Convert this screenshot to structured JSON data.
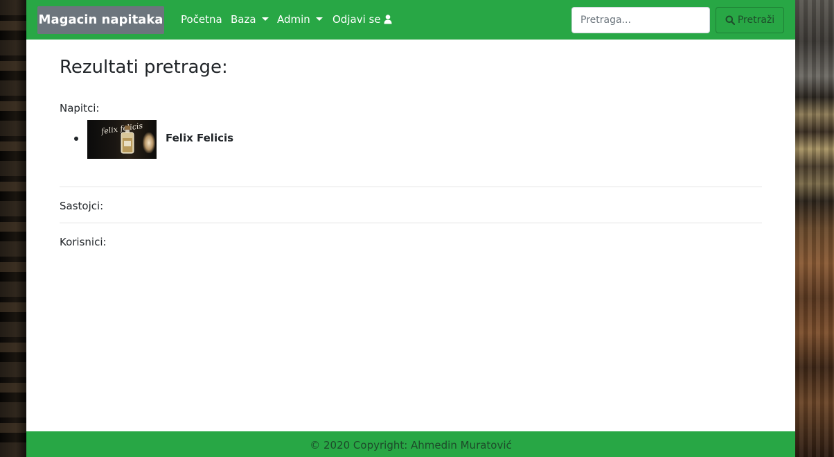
{
  "navbar": {
    "brand": "Magacin napitaka",
    "items": [
      {
        "label": "Početna"
      },
      {
        "label": "Baza"
      },
      {
        "label": "Admin"
      },
      {
        "label": "Odjavi se"
      }
    ],
    "search_placeholder": "Pretraga...",
    "search_button": "Pretraži",
    "background": "#28a745",
    "brand_background": "#6c757d"
  },
  "main": {
    "title": "Rezultati pretrage:",
    "sections": {
      "potions_label": "Napitci:",
      "ingredients_label": "Sastojci:",
      "users_label": "Korisnici:"
    },
    "potions": [
      {
        "name": "Felix Felicis",
        "image_text": "felix felicis",
        "icon": "potion-bottle-icon"
      }
    ]
  },
  "footer": {
    "text": "© 2020 Copyright: Ahmedin Muratović"
  }
}
